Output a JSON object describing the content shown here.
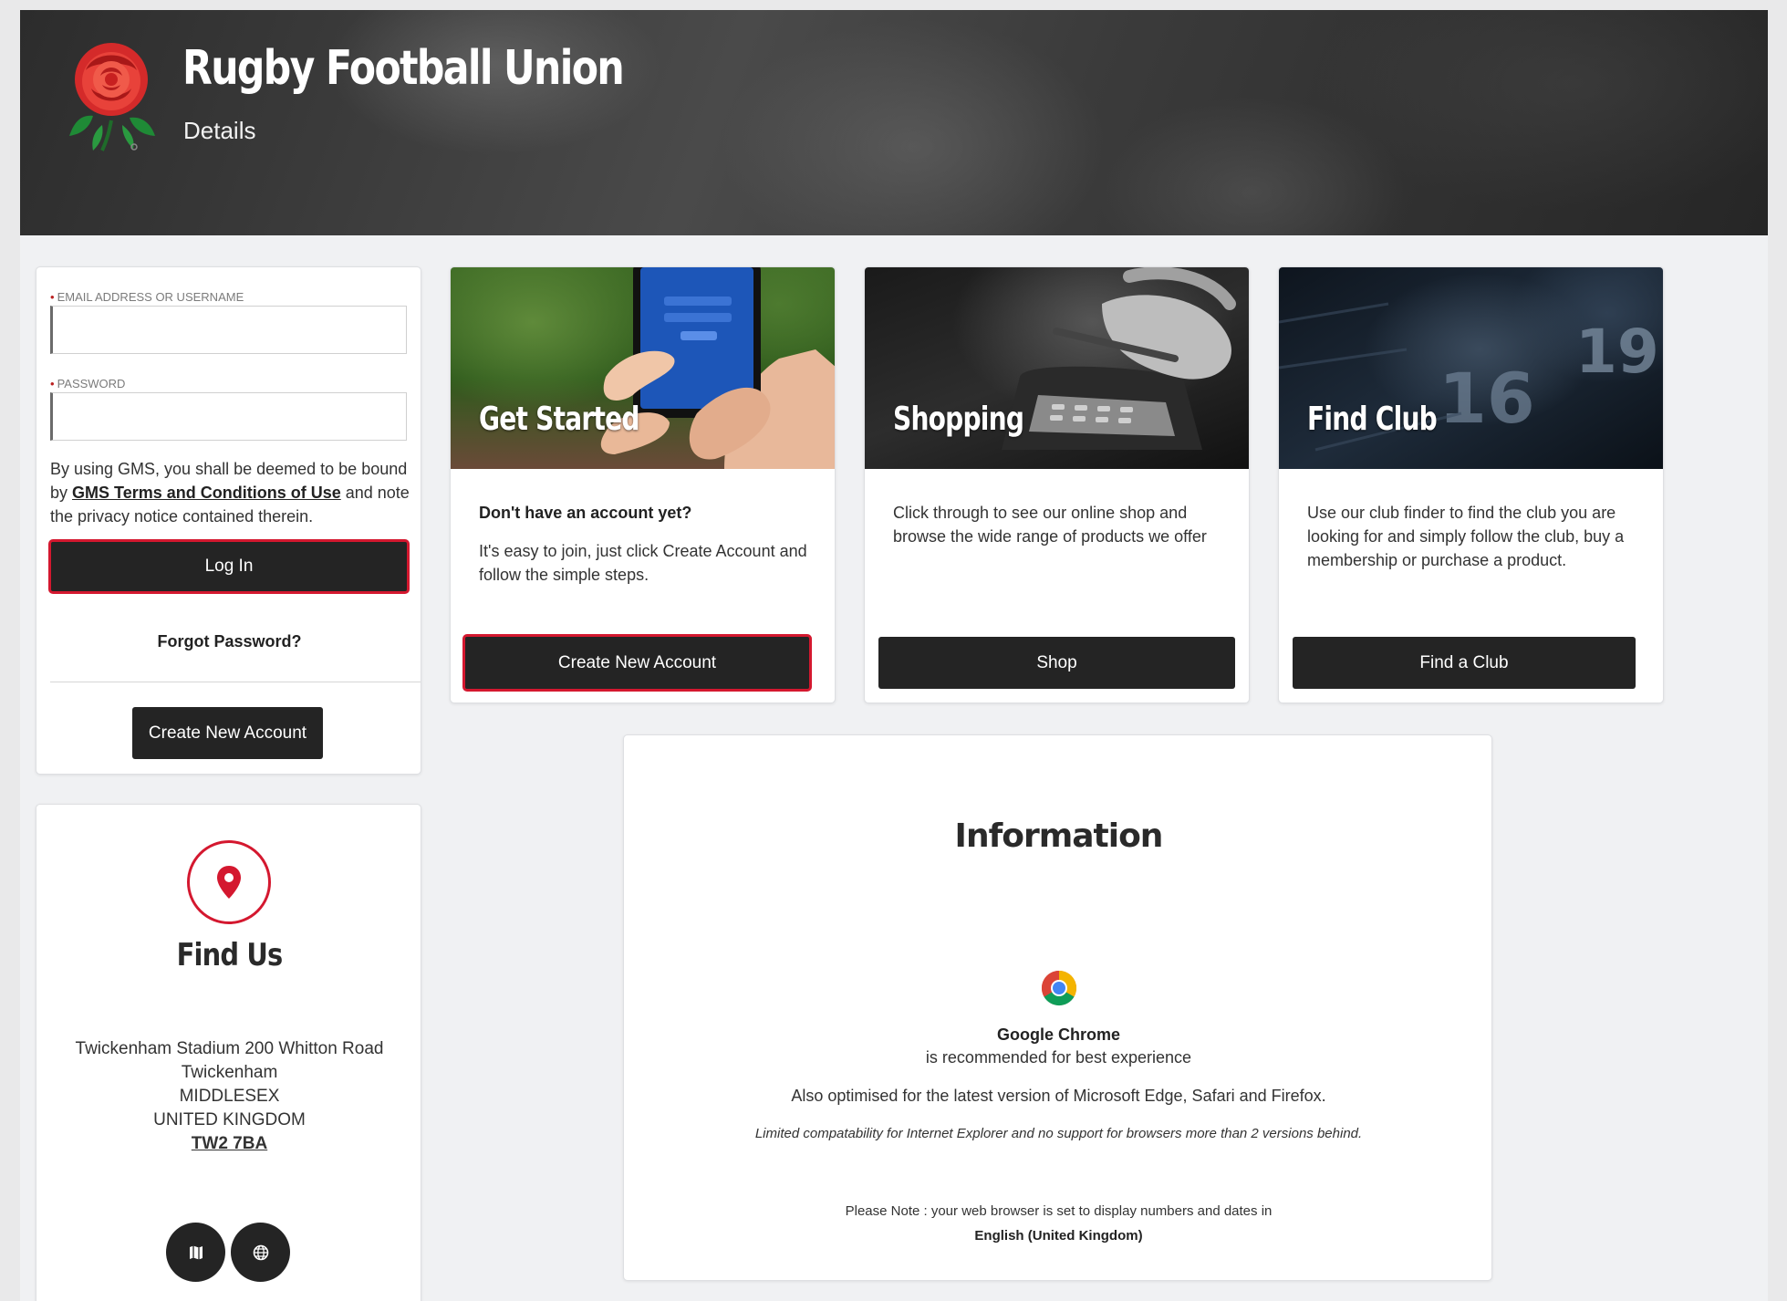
{
  "header": {
    "title": "Rugby Football Union",
    "subtitle": "Details"
  },
  "login": {
    "email_label": "EMAIL ADDRESS OR USERNAME",
    "email_value": "",
    "password_label": "PASSWORD",
    "password_value": "",
    "terms_prefix": "By using GMS, you shall be deemed to be bound by",
    "terms_link": "GMS Terms and Conditions of Use",
    "terms_suffix": "and note the privacy notice contained therein.",
    "login_button": "Log In",
    "forgot_password": "Forgot Password?",
    "create_account_button": "Create New Account"
  },
  "find_us": {
    "title": "Find Us",
    "address_line1": "Twickenham Stadium 200 Whitton Road",
    "address_line2": "Twickenham",
    "address_line3": "MIDDLESEX",
    "address_line4": "UNITED KINGDOM",
    "postcode": "TW2 7BA",
    "map_icon": "map-icon",
    "globe_icon": "globe-icon"
  },
  "tiles": [
    {
      "title": "Get Started",
      "question": "Don't have an account yet?",
      "body": "It's easy to join, just click Create Account and follow the simple steps.",
      "button": "Create New Account"
    },
    {
      "title": "Shopping",
      "body": "Click through to see our online shop and browse the wide range of products we offer",
      "button": "Shop"
    },
    {
      "title": "Find Club",
      "body": "Use our club finder to find the club you are looking for and simply follow the club, buy a membership or purchase a product.",
      "button": "Find a Club"
    }
  ],
  "info": {
    "title": "Information",
    "browser_name": "Google Chrome",
    "browser_note": "is recommended for best experience",
    "also": "Also optimised for the latest version of Microsoft Edge, Safari and Firefox.",
    "limited": "Limited compatability for Internet Explorer and no support for browsers more than 2 versions behind.",
    "locale_note": "Please Note : your web browser is set to display numbers and dates in",
    "locale": "English (United Kingdom)"
  },
  "colors": {
    "accent": "#d4182f",
    "button": "#242424",
    "background": "#f0f1f3"
  }
}
